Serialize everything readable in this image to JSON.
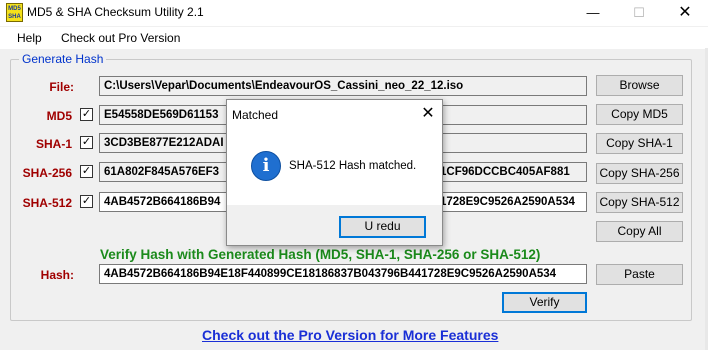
{
  "window": {
    "title": "MD5 & SHA Checksum Utility 2.1",
    "icon_text_top": "MD5",
    "icon_text_bottom": "SHA",
    "minimize_glyph": "—",
    "maximize_glyph": "☐",
    "close_glyph": "✕"
  },
  "menu": {
    "help": "Help",
    "pro": "Check out Pro Version"
  },
  "generate": {
    "group_title": "Generate Hash",
    "file_label": "File:",
    "file_path": "C:\\Users\\Vepar\\Documents\\EndeavourOS_Cassini_neo_22_12.iso",
    "browse": "Browse",
    "rows": [
      {
        "label": "MD5",
        "checked": "✓",
        "value": "E54558DE569D61153",
        "value_tail": "",
        "button": "Copy MD5"
      },
      {
        "label": "SHA-1",
        "checked": "✓",
        "value": "3CD3BE877E212ADAI",
        "value_tail": "",
        "button": "Copy SHA-1"
      },
      {
        "label": "SHA-256",
        "checked": "✓",
        "value": "61A802F845A576EF3",
        "value_tail": "1CF96DCCBC405AF881",
        "button": "Copy SHA-256"
      },
      {
        "label": "SHA-512",
        "checked": "✓",
        "value": "4AB4572B664186B94",
        "value_tail": "1728E9C9526A2590A534",
        "button": "Copy SHA-512"
      }
    ],
    "copy_all": "Copy All"
  },
  "verify": {
    "title": "Verify Hash with Generated Hash (MD5, SHA-1, SHA-256 or SHA-512)",
    "hash_label": "Hash:",
    "hash_value": "4AB4572B664186B94E18F440899CE18186837B043796B441728E9C9526A2590A534",
    "paste": "Paste",
    "verify_button": "Verify"
  },
  "footer_link": "Check out the Pro Version for More Features",
  "dialog": {
    "title": "Matched",
    "close_glyph": "✕",
    "icon": "info-icon",
    "icon_glyph": "i",
    "message": "SHA-512 Hash matched.",
    "ok": "U redu"
  }
}
